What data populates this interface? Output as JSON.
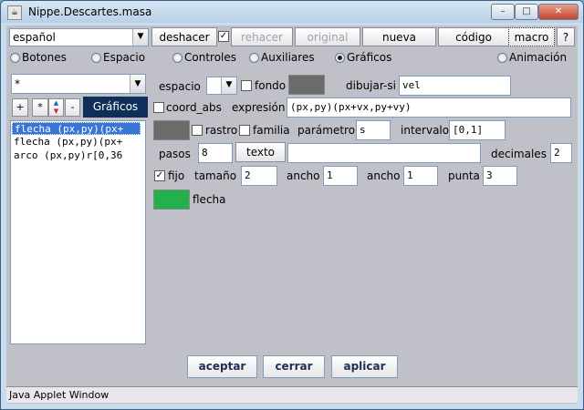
{
  "window": {
    "title": "Nippe.Descartes.masa",
    "icon_glyph": "☕",
    "minimize_glyph": "–",
    "maximize_glyph": "□",
    "close_glyph": "✕"
  },
  "toolbar": {
    "language": "español",
    "undo": "deshacer",
    "redo": "rehacer",
    "original": "original",
    "new": "nueva",
    "code": "código",
    "macro": "macro",
    "help": "?",
    "undo_checked": true
  },
  "tabs": [
    {
      "label": "Botones",
      "selected": false
    },
    {
      "label": "Espacio",
      "selected": false
    },
    {
      "label": "Controles",
      "selected": false
    },
    {
      "label": "Auxiliares",
      "selected": false
    },
    {
      "label": "Gráficos",
      "selected": true
    },
    {
      "label": "Animación",
      "selected": false
    }
  ],
  "left_panel": {
    "filter": "*",
    "add": "+",
    "star": "*",
    "up": "▲",
    "down": "▼",
    "remove": "-",
    "section_title": "Gráficos",
    "items": [
      {
        "text": "flecha (px,py)(px+",
        "selected": true
      },
      {
        "text": "flecha (px,py)(px+",
        "selected": false
      },
      {
        "text": "arco (px,py)r[0,36",
        "selected": false
      }
    ]
  },
  "form": {
    "space_label": "espacio",
    "space_value": "",
    "fondo_label": "fondo",
    "fondo_checked": false,
    "dibujar_si_label": "dibujar-si",
    "dibujar_si_value": "vel",
    "coord_abs_label": "coord_abs",
    "coord_abs_checked": false,
    "expresion_label": "expresión",
    "expresion_value": "(px,py)(px+vx,py+vy)",
    "rastro_label": "rastro",
    "rastro_checked": false,
    "familia_label": "familia",
    "familia_checked": false,
    "parametro_label": "parámetro",
    "parametro_value": "s",
    "intervalo_label": "intervalo",
    "intervalo_value": "[0,1]",
    "pasos_label": "pasos",
    "pasos_value": "8",
    "texto_button": "texto",
    "texto_value": "",
    "decimales_label": "decimales",
    "decimales_value": "2",
    "fijo_label": "fijo",
    "fijo_checked": true,
    "tamano_label": "tamaño",
    "tamano_value": "2",
    "ancho1_label": "ancho",
    "ancho1_value": "1",
    "ancho2_label": "ancho",
    "ancho2_value": "1",
    "punta_label": "punta",
    "punta_value": "3",
    "flecha_label": "flecha"
  },
  "colors": {
    "fondo": "#6b6b6b",
    "rastro": "#6b6b6b",
    "flecha": "#22b14c",
    "selection": "#3875d7",
    "section_header": "#0f2f5a"
  },
  "buttons": {
    "accept": "aceptar",
    "close": "cerrar",
    "apply": "aplicar"
  },
  "status": "Java Applet Window"
}
